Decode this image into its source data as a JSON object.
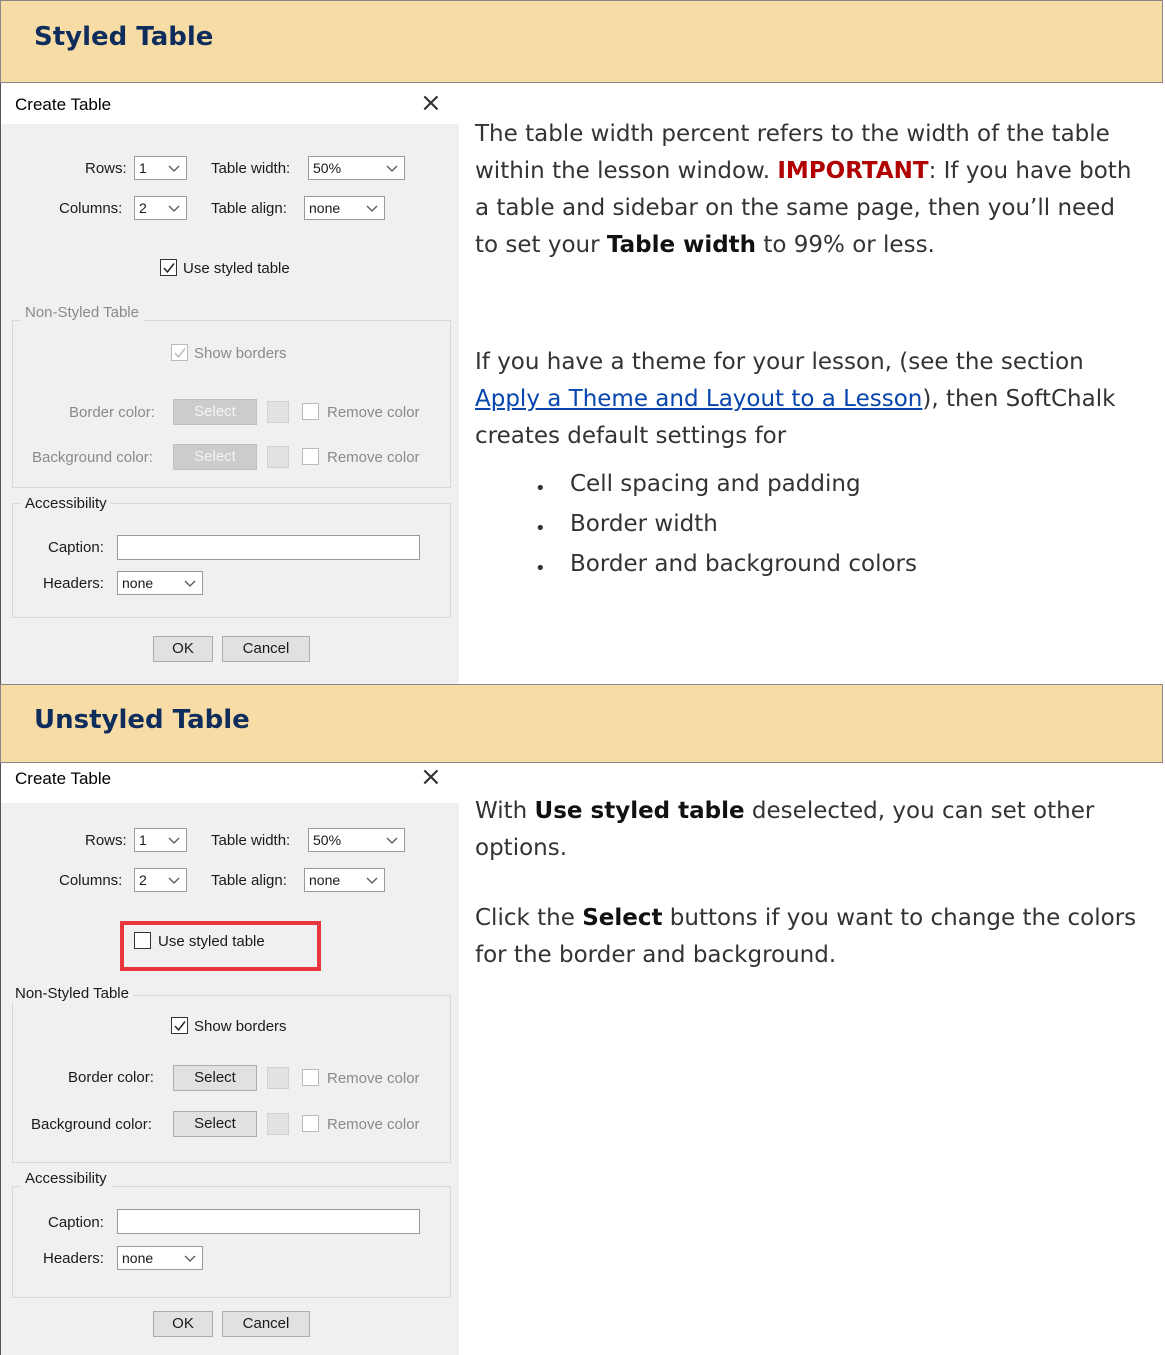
{
  "sections": {
    "styled": {
      "heading": "Styled Table"
    },
    "unstyled": {
      "heading": "Unstyled Table"
    }
  },
  "dialog": {
    "title": "Create Table",
    "close_icon": "close-icon",
    "rows_label": "Rows:",
    "columns_label": "Columns:",
    "table_width_label": "Table width:",
    "table_align_label": "Table align:",
    "use_styled_label": "Use styled table",
    "non_styled_group": "Non-Styled Table",
    "show_borders_label": "Show borders",
    "border_color_label": "Border color:",
    "background_color_label": "Background color:",
    "select_label": "Select",
    "remove_color_label": "Remove color",
    "accessibility_group": "Accessibility",
    "caption_label": "Caption:",
    "headers_label": "Headers:",
    "ok_label": "OK",
    "cancel_label": "Cancel"
  },
  "dialog_styled": {
    "rows": "1",
    "columns": "2",
    "table_width": "50%",
    "table_align": "none",
    "headers": "none",
    "caption": "",
    "use_styled_checked": true,
    "show_borders_checked": true,
    "non_styled_enabled": false
  },
  "dialog_unstyled": {
    "rows": "1",
    "columns": "2",
    "table_width": "50%",
    "table_align": "none",
    "headers": "none",
    "caption": "",
    "use_styled_checked": false,
    "show_borders_checked": true,
    "non_styled_enabled": true
  },
  "styled_text": {
    "p1_a": "The table width percent refers to the width of the table within the lesson window. ",
    "p1_important": "IMPORTANT",
    "p1_b": ": If you have both a table and sidebar on the same page, then you’ll need to set your ",
    "p1_bold": "Table width",
    "p1_c": " to 99% or less.",
    "p2_a": "If you have a theme for your lesson, (see the section ",
    "p2_link": "Apply a Theme and Layout to a Lesson",
    "p2_b": "), then SoftChalk creates default settings for",
    "bullets": [
      "Cell spacing and padding",
      "Border width",
      "Border and background colors"
    ]
  },
  "unstyled_text": {
    "p1_a": "With ",
    "p1_bold": "Use styled table",
    "p1_b": " deselected, you can set other options.",
    "p2_a": "Click the ",
    "p2_bold": "Select",
    "p2_b": " buttons if you want to change the colors for the border and background."
  },
  "colors": {
    "header_bg": "#f8dca6",
    "heading_text": "#0f2d5c",
    "important": "#b00000",
    "link": "#0645ad",
    "highlight": "#e8363e"
  }
}
